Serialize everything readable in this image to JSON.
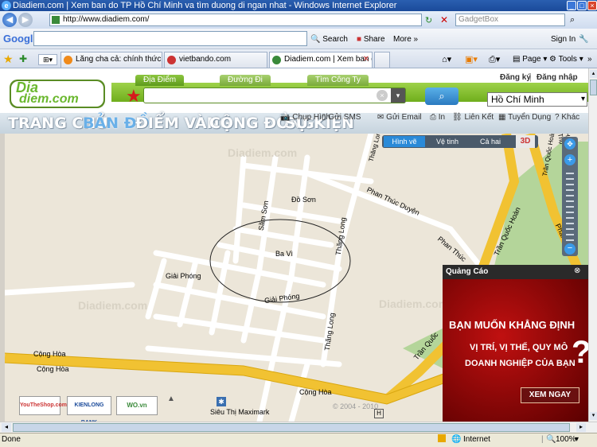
{
  "window": {
    "title": "Diadiem.com | Xem ban do TP Hồ Chí Minh va tìm duong di ngan nhat - Windows Internet Explorer"
  },
  "address": {
    "url": "http://www.diadiem.com/",
    "search_placeholder": "GadgetBox"
  },
  "google_toolbar": {
    "logo": "Google",
    "search_label": "Search",
    "share_label": "Share",
    "more_label": "More »",
    "signin_label": "Sign In"
  },
  "tabs": [
    {
      "label": "Lăng cha cả: chính thức cấm ...",
      "active": false
    },
    {
      "label": "vietbando.com",
      "active": false
    },
    {
      "label": "Diadiem.com | Xem ban d...",
      "active": true
    }
  ],
  "ie_toolbar": {
    "page_label": "Page",
    "tools_label": "Tools"
  },
  "site": {
    "logo_top": "Dia",
    "logo_bottom": "diem.com",
    "search_tabs": [
      "Địa Điểm",
      "Đường Đi",
      "Tìm Công Ty"
    ],
    "account": {
      "register": "Đăng ký",
      "login": "Đăng nhập"
    },
    "city": "Hồ Chí Minh",
    "nav": [
      "TRANG CHỦ",
      "BẢN ĐỒ",
      "ĐIỂM VÀNG",
      "CỘNG ĐỒNG",
      "SỰ KIỆN"
    ],
    "nav_active_index": 1,
    "tools": [
      "Chụp Hình",
      "Gửi SMS",
      "Gửi Email",
      "In",
      "Liên Kết",
      "Tuyển Dụng",
      "Khác"
    ]
  },
  "map": {
    "view_modes": [
      "Hình vẽ",
      "Vệ tinh",
      "Cả hai"
    ],
    "active_mode": "Hình vẽ",
    "badge_3d": "3D",
    "streets": [
      "Thăng Long",
      "Đồ Sơn",
      "Phan Thúc Duyện",
      "Sầm Sơn",
      "Ba Vì",
      "Thăng Long",
      "Giải Phóng",
      "Giải Phóng",
      "Phan Thúc",
      "Trần Quốc Hoàn",
      "Phan Đình",
      "Cộng Hòa",
      "Cộng Hòa",
      "Cộng Hòa",
      "Thăng Long",
      "Trần Quốc",
      "Trần Quốc Hoàn",
      "Hoàng Văn Thụ"
    ],
    "poi": "Siêu Thị Maximark",
    "copyright": "© 2004 - 2010",
    "watermark": "Diadiem.com",
    "sponsors": [
      "YouTheShop.com",
      "KIENLONG BANK",
      "WO.vn"
    ]
  },
  "ad": {
    "header": "Quảng Cáo",
    "line1": "BẠN MUỐN KHẲNG ĐỊNH",
    "line2": "VỊ TRÍ, VỊ THẾ, QUY MÔ",
    "line3": "DOANH NGHIỆP CỦA BẠN",
    "question": "?",
    "cta": "XEM NGAY"
  },
  "status": {
    "left": "Done",
    "zone": "Internet",
    "zoom": "100%"
  }
}
